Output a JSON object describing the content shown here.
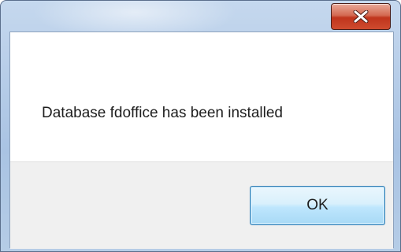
{
  "dialog": {
    "message": "Database fdoffice has been installed",
    "ok_label": "OK",
    "close_icon": "close-icon"
  },
  "colors": {
    "close_button": "#c7432a",
    "ok_button_border": "#3c7fb1",
    "frame": "#b7cde8",
    "button_area": "#f0f0f0"
  }
}
